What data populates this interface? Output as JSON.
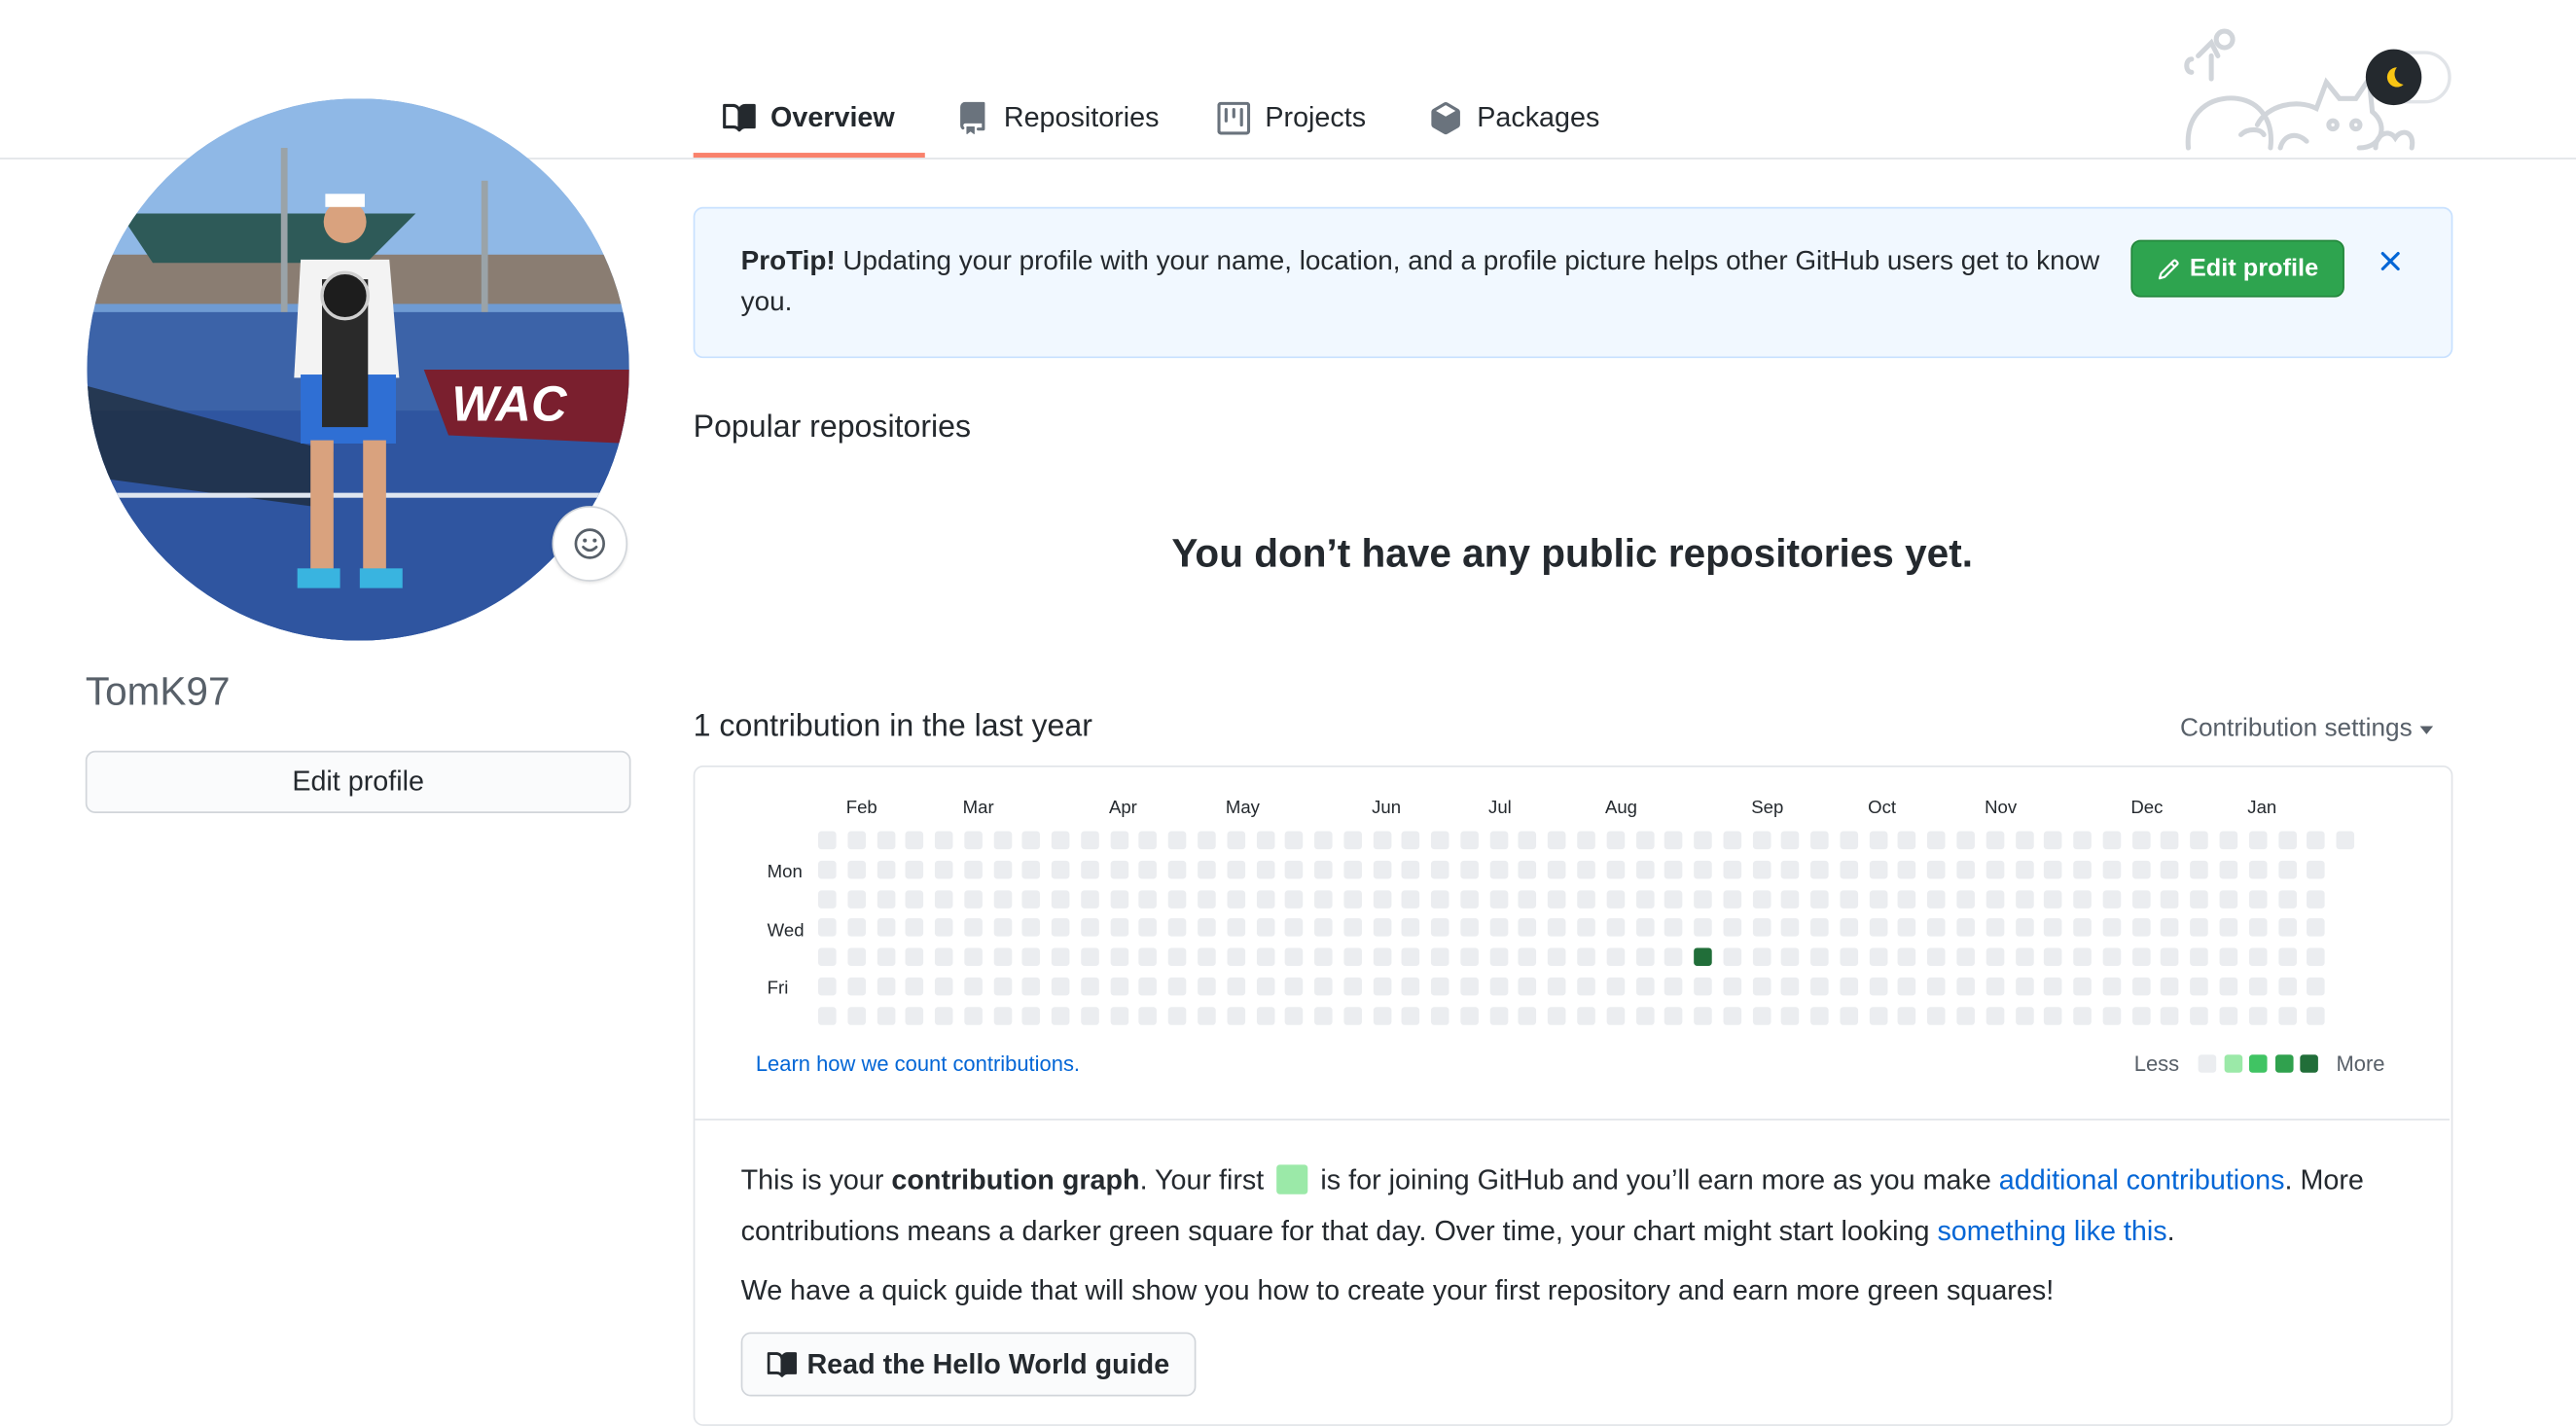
{
  "nav": {
    "tabs": [
      {
        "label": "Overview",
        "icon": "book-icon",
        "active": true
      },
      {
        "label": "Repositories",
        "icon": "repo-icon"
      },
      {
        "label": "Projects",
        "icon": "project-icon"
      },
      {
        "label": "Packages",
        "icon": "package-icon"
      }
    ]
  },
  "header": {
    "illustration": "octocat-line-art",
    "theme_toggle": "moon-icon"
  },
  "profile": {
    "username": "TomK97",
    "edit_profile_label": "Edit profile",
    "avatar_description": "photo"
  },
  "protip": {
    "bold": "ProTip!",
    "text": " Updating your profile with your name, location, and a profile picture helps other GitHub users get to know you.",
    "button_label": "Edit profile"
  },
  "popular": {
    "heading": "Popular repositories",
    "empty_message": "You don’t have any public repositories yet."
  },
  "contributions": {
    "heading": "1 contribution in the last year",
    "settings_label": "Contribution settings",
    "months": [
      "Feb",
      "Mar",
      "Apr",
      "May",
      "Jun",
      "Jul",
      "Aug",
      "Sep",
      "Oct",
      "Nov",
      "Dec",
      "Jan"
    ],
    "days": [
      "Mon",
      "Wed",
      "Fri"
    ],
    "weeks": 53,
    "active_day": {
      "week": 30,
      "weekday": 4,
      "level": 4
    },
    "learn_link": "Learn how we count contributions.",
    "legend_less": "Less",
    "legend_more": "More",
    "colors": [
      "#ebedf0",
      "#9be9a8",
      "#40c463",
      "#30a14e",
      "#216e39"
    ]
  },
  "intro": {
    "p1_a": "This is your ",
    "p1_b": "contribution graph",
    "p1_c": ". Your first ",
    "p1_d": " is for joining GitHub and you’ll earn more as you make ",
    "p1_link1": "additional contributions",
    "p1_e": ". More",
    "p1_f": "contributions means a darker green square for that day. Over time, your chart might start looking ",
    "p1_link2": "something like this",
    "p1_g": ".",
    "p2": "We have a quick guide that will show you how to create your first repository and earn more green squares!",
    "guide_button": "Read the Hello World guide"
  }
}
